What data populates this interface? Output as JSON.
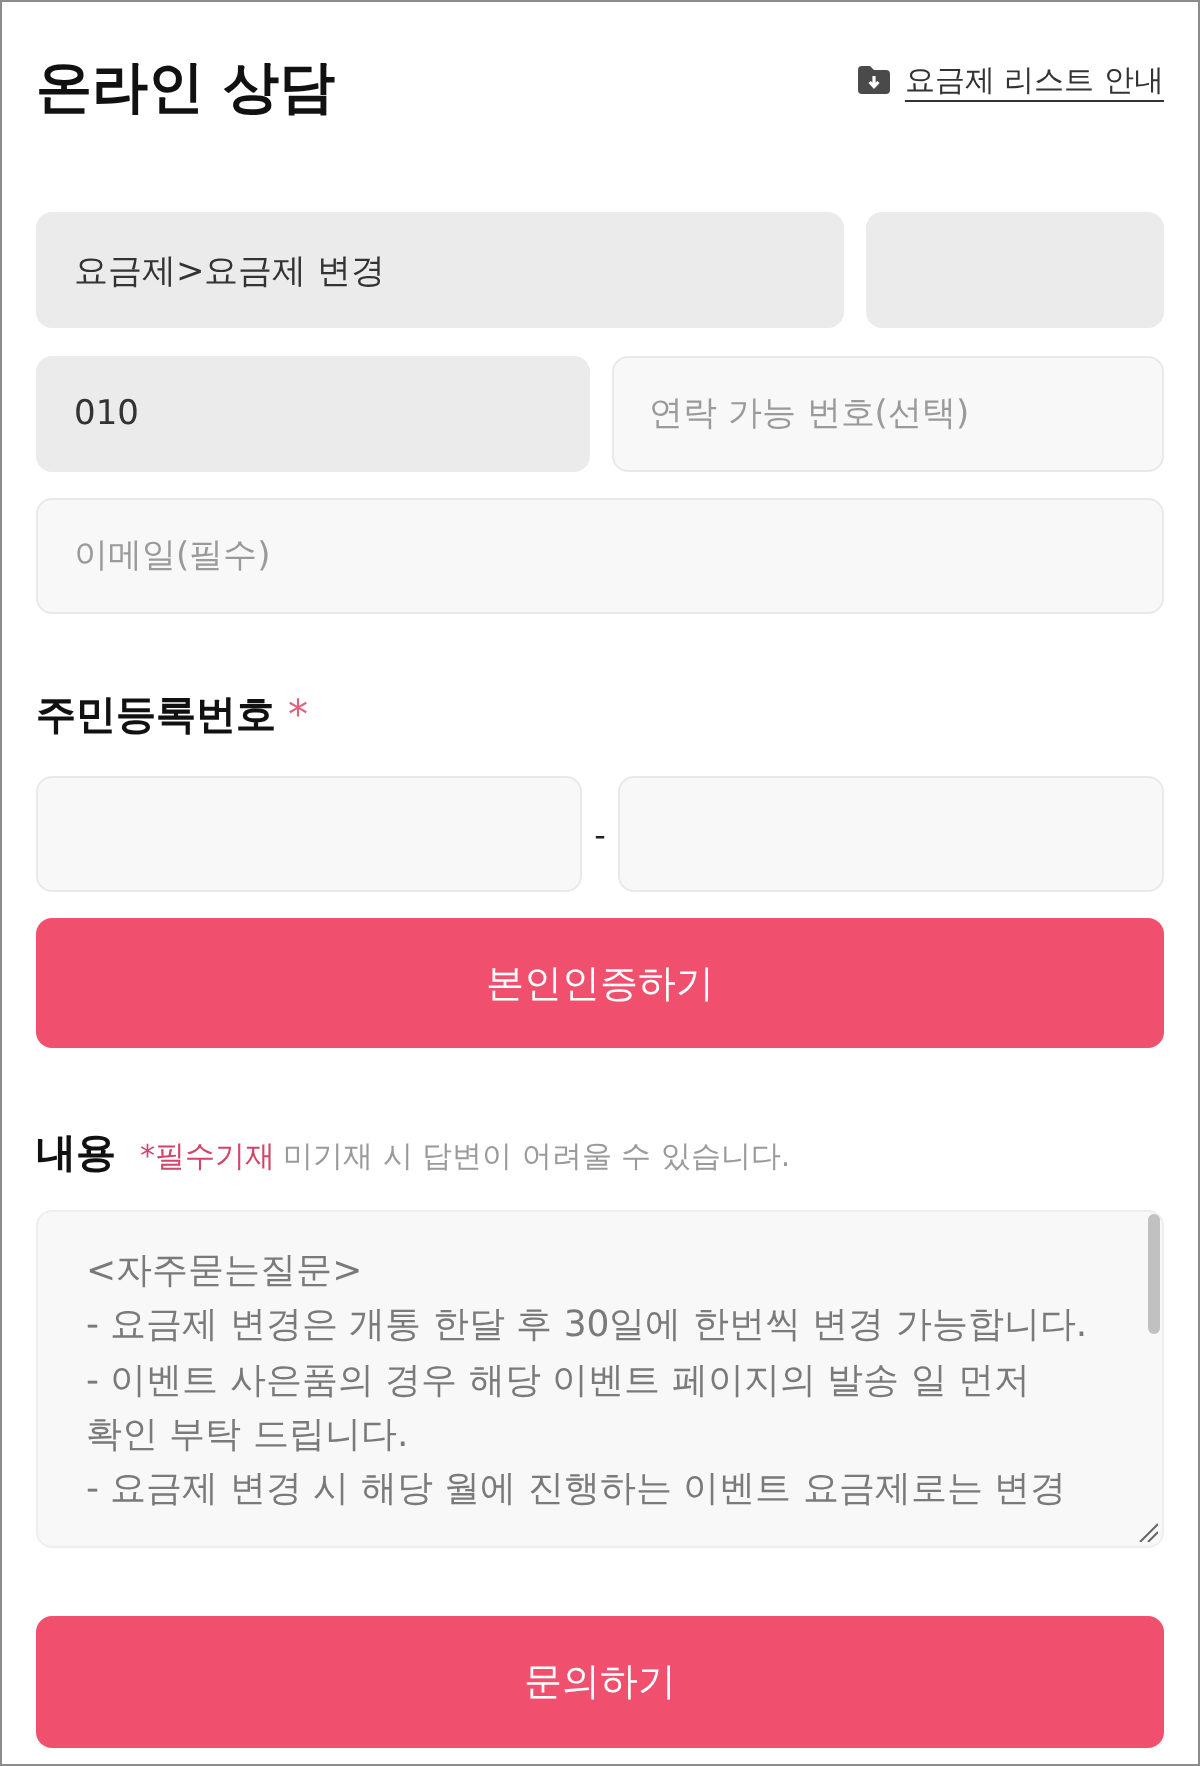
{
  "header": {
    "title": "온라인 상담",
    "link": {
      "label": "요금제 리스트 안내"
    }
  },
  "contact_rows": [
    {
      "fields": [
        {
          "value": "요금제>요금제 변경",
          "disabled": true
        },
        {
          "disabled": true
        }
      ]
    },
    {
      "fields": [
        {
          "value": "010",
          "disabled": true
        },
        {
          "placeholder": "연락 가능 번호(선택)",
          "disabled": false
        }
      ]
    },
    {
      "fields": [
        {
          "placeholder": "이메일(필수)",
          "disabled": false
        }
      ]
    }
  ],
  "resident_number": {
    "label": "주민등록번호",
    "required_mark": "*",
    "separator": "-",
    "fields": [
      {
        "disabled": false
      },
      {
        "disabled": false
      }
    ]
  },
  "verify_button": "본인인증하기",
  "content": {
    "label": "내용",
    "required_note": "*필수기재",
    "hint": "미기재 시 답변이 어려울 수 있습니다.",
    "message": {
      "placeholder": "<자주묻는질문>\n- 요금제 변경은 개통 한달 후 30일에 한번씩 변경 가능합니다.\n- 이벤트 사은품의 경우 해당 이벤트 페이지의 발송 일 먼저 확인 부탁 드립니다.\n- 요금제 변경 시 해당 월에 진행하는 이벤트 요금제로는 변경"
    }
  },
  "submit_button": "문의하기"
}
